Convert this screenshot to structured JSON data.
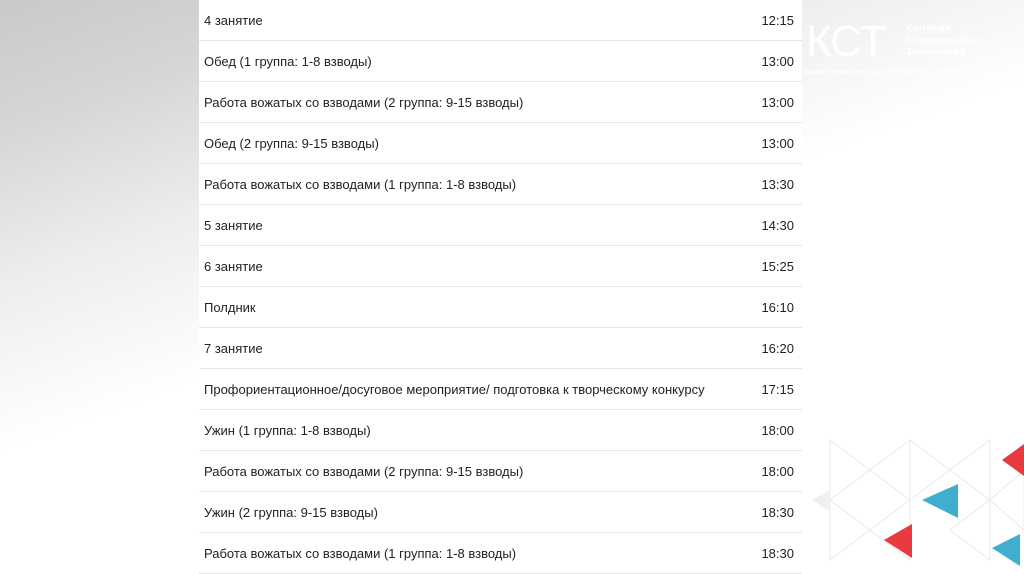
{
  "logo": {
    "mark": "КСТ",
    "name_lines": [
      "Колледж",
      "Современных",
      "Технологий"
    ],
    "subtitle": "имени Героя Советского Союза М.Ф. Панова"
  },
  "colors": {
    "accent_red": "#e8242a",
    "accent_blue": "#2aa6c8",
    "text": "#222222"
  },
  "schedule": [
    {
      "name": "4 занятие",
      "time": "12:15"
    },
    {
      "name": "Обед (1 группа: 1-8 взводы)",
      "time": "13:00"
    },
    {
      "name": "Работа вожатых со взводами (2 группа: 9-15 взводы)",
      "time": "13:00"
    },
    {
      "name": "Обед (2 группа: 9-15 взводы)",
      "time": "13:00"
    },
    {
      "name": "Работа вожатых со взводами (1 группа: 1-8 взводы)",
      "time": "13:30"
    },
    {
      "name": "5 занятие",
      "time": "14:30"
    },
    {
      "name": "6 занятие",
      "time": "15:25"
    },
    {
      "name": "Полдник",
      "time": "16:10"
    },
    {
      "name": "7 занятие",
      "time": "16:20"
    },
    {
      "name": "Профориентационное/досуговое мероприятие/ подготовка к творческому конкурсу",
      "time": "17:15"
    },
    {
      "name": "Ужин (1 группа: 1-8 взводы)",
      "time": "18:00"
    },
    {
      "name": "Работа вожатых со взводами (2 группа: 9-15 взводы)",
      "time": "18:00"
    },
    {
      "name": "Ужин (2 группа: 9-15 взводы)",
      "time": "18:30"
    },
    {
      "name": "Работа вожатых со взводами (1 группа: 1-8 взводы)",
      "time": "18:30"
    }
  ]
}
